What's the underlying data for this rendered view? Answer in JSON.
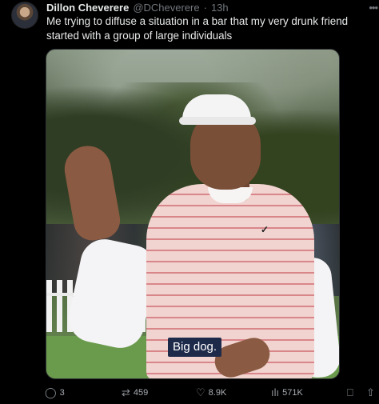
{
  "author": {
    "name": "Dillon Cheverere",
    "handle": "@DCheverere",
    "separator": "·",
    "time": "13h"
  },
  "tweet": {
    "text": "Me trying to diffuse a situation in a bar that my very drunk friend started with a group of large individuals"
  },
  "media": {
    "caption": "Big dog."
  },
  "actions": {
    "replies": "3",
    "reposts": "459",
    "likes": "8.9K",
    "views": "571K"
  },
  "icons": {
    "more": "more-horizontal-icon",
    "reply": "reply-icon",
    "repost": "repost-icon",
    "like": "heart-icon",
    "views": "views-chart-icon",
    "bookmark": "bookmark-icon",
    "share": "share-icon"
  }
}
